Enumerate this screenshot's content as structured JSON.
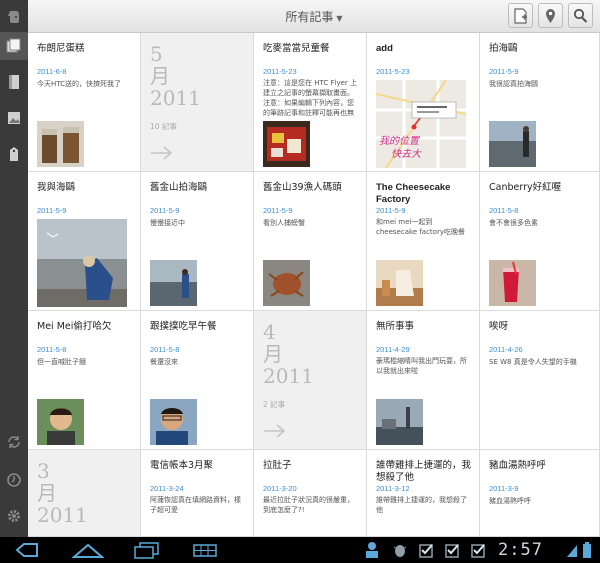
{
  "header": {
    "title": "所有記事"
  },
  "toolbar": {
    "new_note_icon": "new-note-icon",
    "location_icon": "map-pin-icon",
    "search_icon": "search-icon"
  },
  "sidebar": {
    "items": [
      "evernote-logo-icon",
      "notes-icon",
      "notebooks-icon",
      "image-icon",
      "tag-icon",
      "sync-icon",
      "clock-icon",
      "settings-icon"
    ]
  },
  "notes": [
    {
      "title": "布朗尼蛋糕",
      "date": "2011-6-8",
      "snippet": "今天HTC送的，快擠死我了"
    },
    {
      "title": "吃麥當當兒童餐",
      "date": "2011-5-23",
      "snippet": "注意：這是您在 HTC Flyer 上建立之記事的螢幕擷取畫面。注意：如果編輯下列內容，您的筆跡記事和註釋可能再也無"
    },
    {
      "title": "add",
      "date": "2011-5-23",
      "snippet": ""
    },
    {
      "title": "拍海鷗",
      "date": "2011-5-9",
      "snippet": "我很認真拍海鷗"
    },
    {
      "title": "我與海鷗",
      "date": "2011-5-9",
      "snippet": ""
    },
    {
      "title": "舊金山拍海鷗",
      "date": "2011-5-9",
      "snippet": "慢慢接近中"
    },
    {
      "title": "舊金山39漁人碼頭",
      "date": "2011-5-9",
      "snippet": "看別人捕螃蟹"
    },
    {
      "title": "The Cheesecake Factory",
      "date": "2011-5-9",
      "snippet": "和mei mei一起到cheesecake factory吃晚餐"
    },
    {
      "title": "Canberry好紅喔",
      "date": "2011-5-8",
      "snippet": "會不會很多色素"
    },
    {
      "title": "Mei Mei偷打哈欠",
      "date": "2011-5-8",
      "snippet": "但一直喊肚子餓"
    },
    {
      "title": "跟撲撲吃早午餐",
      "date": "2011-5-8",
      "snippet": "餐還沒來"
    },
    {
      "title": "無所事事",
      "date": "2011-4-29",
      "snippet": "豪瑪棍縮睛叫我出門玩耍，所以我就出來啦"
    },
    {
      "title": "唉呀",
      "date": "2011-4-26",
      "snippet": "SE W8 真是令人失望的手機"
    },
    {
      "title": "電信帳本3月聚",
      "date": "2011-3-24",
      "snippet": "阿蓮恢認真在填網路資料，樣子超可愛"
    },
    {
      "title": "拉肚子",
      "date": "2011-3-20",
      "snippet": "最近拉肚子狀況真的很嚴重，到底怎麼了?!"
    },
    {
      "title": "誰帶雞排上捷運的，我想殺了他",
      "date": "2011-3-12",
      "snippet": "誰帶雞排上捷運的，我想殺了他"
    },
    {
      "title": "豬血湯熱呼呼",
      "date": "2011-3-9",
      "snippet": "豬血湯熱呼呼"
    }
  ],
  "months": [
    {
      "label": "5\n月\n2011",
      "count": "10 記事"
    },
    {
      "label": "4\n月\n2011",
      "count": "2 記事"
    },
    {
      "label": "3\n月\n2011",
      "count": ""
    }
  ],
  "map_text": {
    "line1": "我的位置",
    "line2": "快去大"
  },
  "statusbar": {
    "time": "2:57"
  },
  "colors": {
    "date_blue": "#3d8fd0",
    "sidebar": "#3a3a3a",
    "clock": "#cfd8dc"
  }
}
